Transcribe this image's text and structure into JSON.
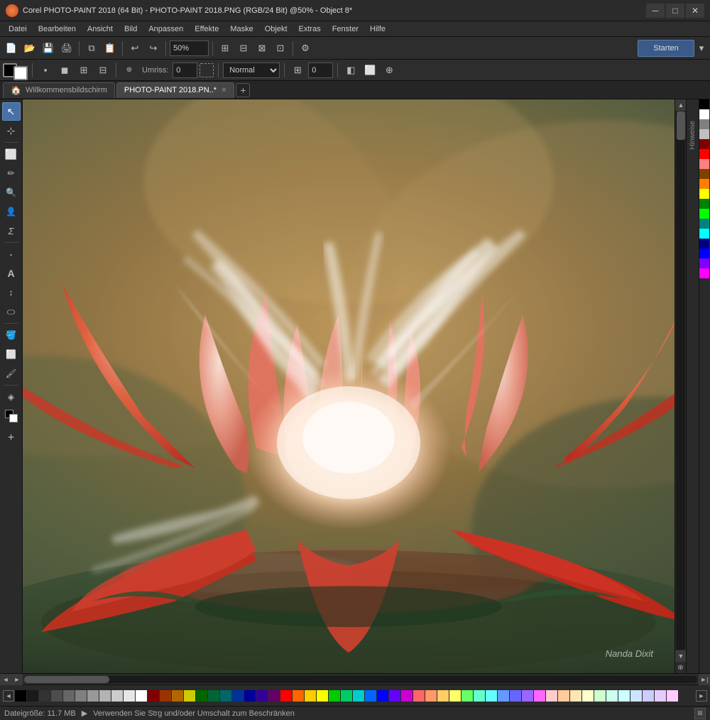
{
  "titlebar": {
    "icon": "🎨",
    "title": "Corel PHOTO-PAINT 2018 (64 Bit) - PHOTO-PAINT 2018.PNG (RGB/24 Bit) @50% - Object 8*",
    "minimize": "─",
    "maximize": "□",
    "close": "✕"
  },
  "menubar": {
    "items": [
      "Datei",
      "Bearbeiten",
      "Ansicht",
      "Bild",
      "Anpassen",
      "Effekte",
      "Maske",
      "Objekt",
      "Extras",
      "Fenster",
      "Hilfe"
    ]
  },
  "toolbar1": {
    "zoom_label": "50%",
    "start_label": "Starten"
  },
  "toolbar2": {
    "outline_label": "Umriss:",
    "outline_value": "0",
    "blend_label": "Normal"
  },
  "tabs": [
    {
      "label": "Willkommensbildschirm",
      "icon": "🏠",
      "active": false
    },
    {
      "label": "PHOTO-PAINT 2018.PN..*",
      "icon": "",
      "active": true
    }
  ],
  "tools": [
    {
      "icon": "↖",
      "name": "select",
      "title": "Auswahl"
    },
    {
      "icon": "⊹",
      "name": "transform",
      "title": "Transform"
    },
    {
      "icon": "⬜",
      "name": "rect-select",
      "title": "Rechteck"
    },
    {
      "icon": "🖊",
      "name": "paint",
      "title": "Malen"
    },
    {
      "icon": "🔍",
      "name": "zoom",
      "title": "Zoom"
    },
    {
      "icon": "👤",
      "name": "eyedropper",
      "title": "Pipette"
    },
    {
      "icon": "Σ",
      "name": "curve",
      "title": "Kurve"
    },
    {
      "icon": "◉",
      "name": "dot",
      "title": "Punkt"
    },
    {
      "icon": "A",
      "name": "text",
      "title": "Text"
    },
    {
      "icon": "↕",
      "name": "vertical",
      "title": "Vertikal"
    },
    {
      "icon": "⬭",
      "name": "ellipse",
      "title": "Ellipse"
    },
    {
      "icon": "🪣",
      "name": "fill",
      "title": "Füllen"
    },
    {
      "icon": "⬜",
      "name": "rect",
      "title": "Rechteck2"
    },
    {
      "icon": "✏",
      "name": "pencil",
      "title": "Stift"
    },
    {
      "icon": "◈",
      "name": "effect",
      "title": "Effekt"
    },
    {
      "icon": "⬛",
      "name": "fg-bg",
      "title": "VG/HG"
    },
    {
      "icon": "+",
      "name": "add-tool",
      "title": "Hinzufügen"
    }
  ],
  "canvas": {
    "watermark": "Nanda Dixit"
  },
  "color_palette_right": [
    "#000000",
    "#ffffff",
    "#808080",
    "#c0c0c0",
    "#800000",
    "#ff0000",
    "#ff8080",
    "#804000",
    "#ff8000",
    "#ffff00",
    "#008000",
    "#00ff00",
    "#008080",
    "#00ffff",
    "#000080",
    "#0000ff",
    "#8000ff",
    "#ff00ff"
  ],
  "color_palette_bottom": [
    "#000000",
    "#1a1a1a",
    "#333333",
    "#4d4d4d",
    "#666666",
    "#808080",
    "#999999",
    "#b3b3b3",
    "#cccccc",
    "#e6e6e6",
    "#ffffff",
    "#800000",
    "#993300",
    "#b36600",
    "#cccc00",
    "#006600",
    "#006633",
    "#006666",
    "#003399",
    "#000099",
    "#330099",
    "#660066",
    "#ff0000",
    "#ff6600",
    "#ffcc00",
    "#ffff00",
    "#00cc00",
    "#00cc66",
    "#00cccc",
    "#0066ff",
    "#0000ff",
    "#6600ff",
    "#cc00cc",
    "#ff6666",
    "#ff9966",
    "#ffcc66",
    "#ffff66",
    "#66ff66",
    "#66ffcc",
    "#66ffff",
    "#6699ff",
    "#6666ff",
    "#9966ff",
    "#ff66ff",
    "#ffcccc",
    "#ffcc99",
    "#ffe5b4",
    "#ffffcc",
    "#ccffcc",
    "#ccffee",
    "#ccffff",
    "#cce5ff",
    "#ccccff",
    "#e5ccff",
    "#ffccff"
  ],
  "statusbar": {
    "filesize": "Dateigröße: 11.7 MB",
    "hint": "Verwenden Sie Strg und/oder Umschalt zum Beschränken"
  }
}
